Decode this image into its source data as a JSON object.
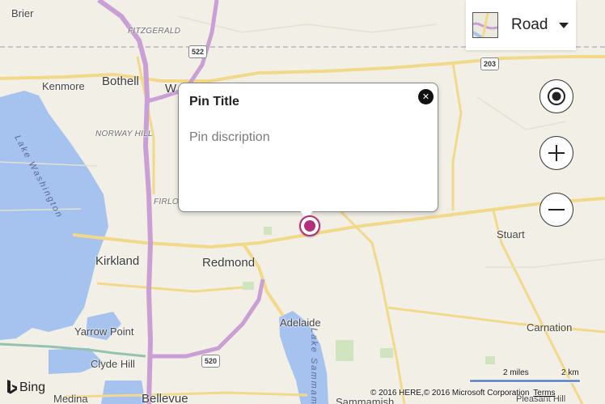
{
  "map": {
    "style_picker": {
      "label": "Road"
    },
    "controls": {
      "locate": "locate-me",
      "zoom_in": "zoom-in",
      "zoom_out": "zoom-out"
    },
    "infobox": {
      "title": "Pin Title",
      "description": "Pin discription"
    },
    "places": {
      "brier": "Brier",
      "kenmore": "Kenmore",
      "bothell": "Bothell",
      "woodinville_partial": "W",
      "fitzgerald": "FITZGERALD",
      "norway_hill": "NORWAY HILL",
      "finn_hill_partial": "FIRLO",
      "kirkland": "Kirkland",
      "redmond": "Redmond",
      "adelaide": "Adelaide",
      "stuart": "Stuart",
      "carnation": "Carnation",
      "yarrow_point": "Yarrow Point",
      "clyde_hill": "Clyde Hill",
      "medina": "Medina",
      "bellevue": "Bellevue",
      "sammamish_partial": "Sammamish",
      "pleasant_hill_partial": "Pleasant Hill",
      "lake_washington": "Lake Washington",
      "lake_sammamish": "Lake Sammamish"
    },
    "shields": [
      "522",
      "203",
      "520"
    ],
    "scale": {
      "miles": "2 miles",
      "km": "2 km"
    },
    "brand": "Bing",
    "attribution": "© 2016 HERE,© 2016 Microsoft Corporation",
    "terms": "Terms",
    "colors": {
      "land": "#f2efe6",
      "water": "#a6c2ee",
      "highway": "#c99fd6",
      "arterial": "#f2d98a",
      "pin": "#b2307a"
    }
  }
}
